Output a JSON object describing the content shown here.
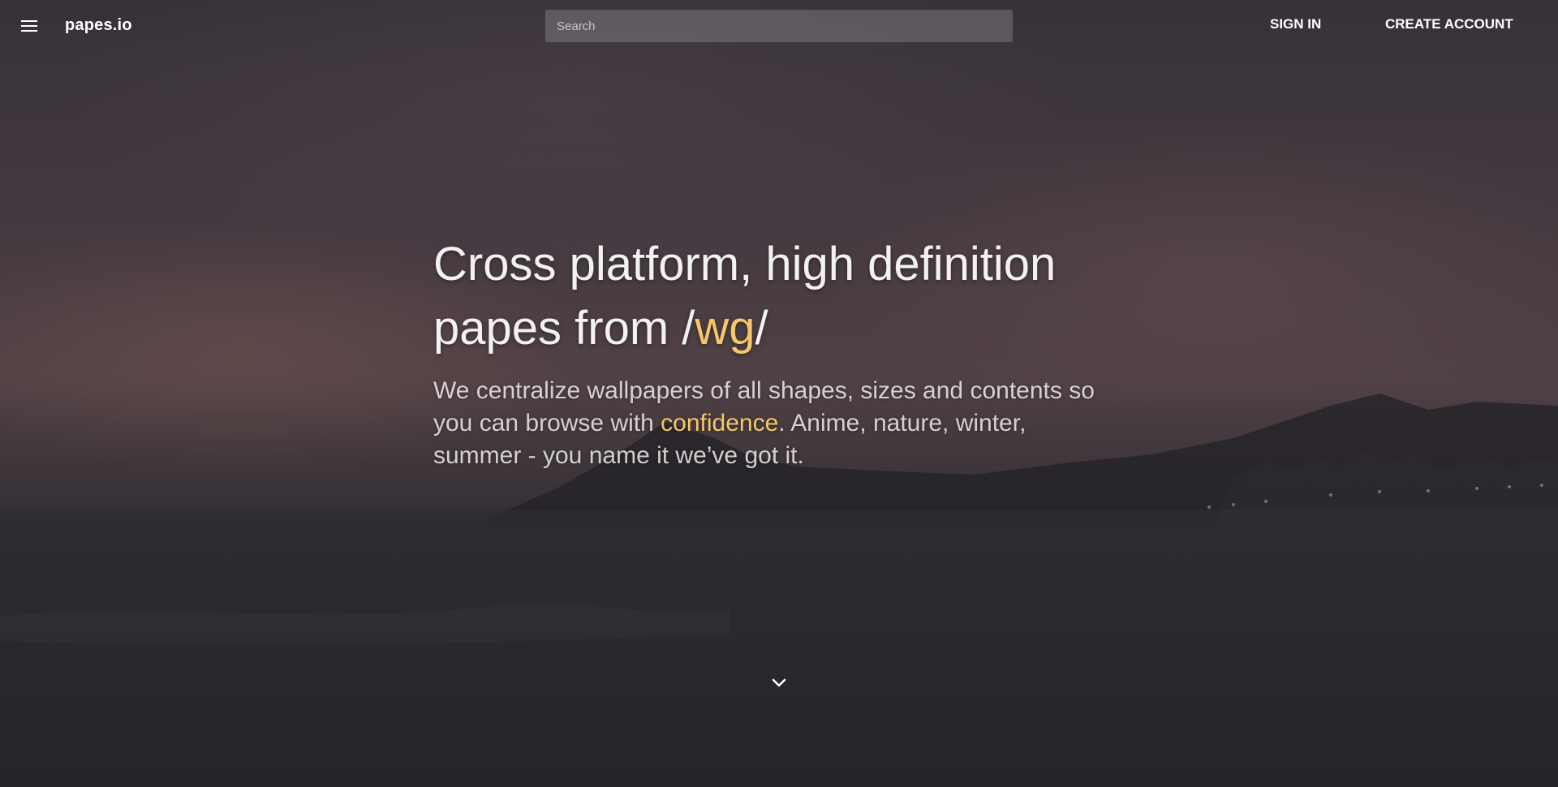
{
  "header": {
    "menu_icon": "hamburger-menu-icon",
    "brand": "papes.io",
    "search": {
      "placeholder": "Search",
      "value": ""
    },
    "sign_in_label": "SIGN IN",
    "create_account_label": "CREATE ACCOUNT"
  },
  "hero": {
    "headline_line1": "Cross platform, high definition",
    "headline_line2_prefix": "papes from /",
    "headline_accent": "wg",
    "headline_line2_suffix": "/",
    "sub_part1": "We centralize wallpapers of all shapes, sizes and contents so you can browse with ",
    "sub_accent": "confidence",
    "sub_part2": ". Anime, nature, winter, summer - you name it we’ve got it.",
    "scroll_icon": "chevron-down-icon"
  },
  "colors": {
    "accent": "#f5c76a",
    "text": "#ffffff"
  }
}
